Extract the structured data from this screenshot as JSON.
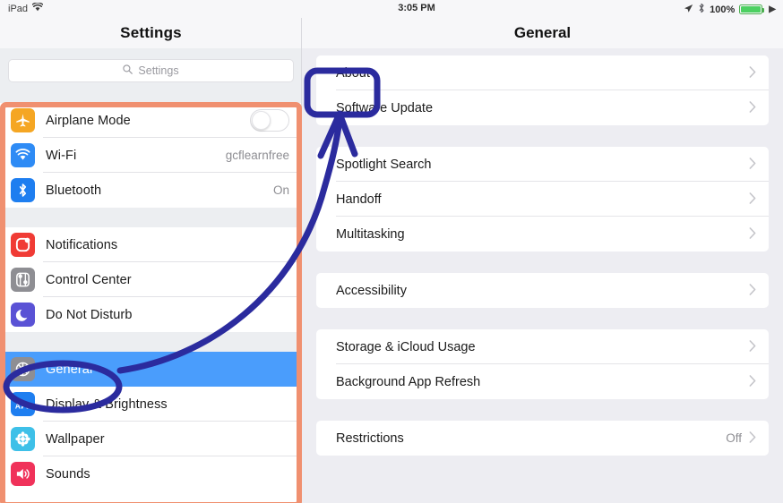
{
  "status_bar": {
    "device_label": "iPad",
    "wifi_icon": "wifi-icon",
    "time": "3:05 PM",
    "location_icon": "location-arrow-icon",
    "bluetooth_icon": "bluetooth-icon",
    "battery_percent": "100%",
    "charging_icon": "lightning-bolt-icon"
  },
  "sidebar": {
    "title": "Settings",
    "search": {
      "placeholder": "Settings",
      "value": "",
      "icon": "search-icon"
    },
    "groups": [
      {
        "items": [
          {
            "label": "Airplane Mode",
            "icon": "airplane-icon",
            "icon_color": "#f5a623",
            "control": "toggle",
            "toggle_on": false,
            "value": ""
          },
          {
            "label": "Wi-Fi",
            "icon": "wifi-icon",
            "icon_color": "#2e8bf5",
            "control": "value",
            "value": "gcflearnfree"
          },
          {
            "label": "Bluetooth",
            "icon": "bluetooth-icon",
            "icon_color": "#1e7ef0",
            "control": "value",
            "value": "On"
          }
        ]
      },
      {
        "items": [
          {
            "label": "Notifications",
            "icon": "notifications-icon",
            "icon_color": "#f03b35",
            "control": "none",
            "value": ""
          },
          {
            "label": "Control Center",
            "icon": "control-center-icon",
            "icon_color": "#8e8e93",
            "control": "none",
            "value": ""
          },
          {
            "label": "Do Not Disturb",
            "icon": "moon-icon",
            "icon_color": "#5a52d5",
            "control": "none",
            "value": ""
          }
        ]
      },
      {
        "items": [
          {
            "label": "General",
            "icon": "gear-icon",
            "icon_color": "#8e8e93",
            "control": "none",
            "value": "",
            "selected": true
          },
          {
            "label": "Display & Brightness",
            "icon": "display-brightness-icon",
            "icon_color": "#1e7ef0",
            "control": "none",
            "value": ""
          },
          {
            "label": "Wallpaper",
            "icon": "wallpaper-icon",
            "icon_color": "#3ec0e8",
            "control": "none",
            "value": ""
          },
          {
            "label": "Sounds",
            "icon": "sounds-icon",
            "icon_color": "#f0325a",
            "control": "none",
            "value": ""
          }
        ]
      }
    ]
  },
  "detail": {
    "title": "General",
    "groups": [
      {
        "items": [
          {
            "label": "About",
            "value": "",
            "chevron": "chevron-right-icon"
          },
          {
            "label": "Software Update",
            "value": "",
            "chevron": "chevron-right-icon"
          }
        ]
      },
      {
        "items": [
          {
            "label": "Spotlight Search",
            "value": "",
            "chevron": "chevron-right-icon"
          },
          {
            "label": "Handoff",
            "value": "",
            "chevron": "chevron-right-icon"
          },
          {
            "label": "Multitasking",
            "value": "",
            "chevron": "chevron-right-icon"
          }
        ]
      },
      {
        "items": [
          {
            "label": "Accessibility",
            "value": "",
            "chevron": "chevron-right-icon"
          }
        ]
      },
      {
        "items": [
          {
            "label": "Storage & iCloud Usage",
            "value": "",
            "chevron": "chevron-right-icon"
          },
          {
            "label": "Background App Refresh",
            "value": "",
            "chevron": "chevron-right-icon"
          }
        ]
      },
      {
        "items": [
          {
            "label": "Restrictions",
            "value": "Off",
            "chevron": "chevron-right-icon"
          }
        ]
      }
    ]
  },
  "annotations": {
    "highlight_box_color": "#f09070",
    "callout_color": "#2b2b9e",
    "selected_row_color": "#4a9dfc",
    "sidebar_outline": "sidebar-list-highlight-box",
    "general_circle": "general-row-callout-circle",
    "about_box": "about-row-callout-box",
    "arrow": "callout-arrow-general-to-about"
  }
}
